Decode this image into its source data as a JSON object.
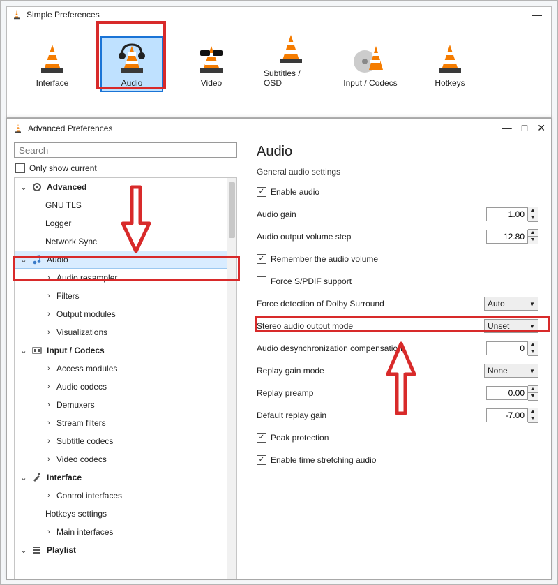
{
  "simple": {
    "title": "Simple Preferences",
    "minimize_glyph": "—",
    "categories": {
      "interface": "Interface",
      "audio": "Audio",
      "video": "Video",
      "subtitles": "Subtitles / OSD",
      "input_codecs": "Input / Codecs",
      "hotkeys": "Hotkeys"
    }
  },
  "advanced": {
    "title": "Advanced Preferences",
    "winbtns": {
      "min": "—",
      "max": "□",
      "close": "✕"
    },
    "search_placeholder": "Search",
    "only_show_current": "Only show current",
    "tree": {
      "advanced": {
        "label": "Advanced",
        "children": {
          "gnu_tls": "GNU TLS",
          "logger": "Logger",
          "network_sync": "Network Sync"
        }
      },
      "audio": {
        "label": "Audio",
        "children": {
          "resampler": "Audio resampler",
          "filters": "Filters",
          "output_modules": "Output modules",
          "visualizations": "Visualizations"
        }
      },
      "input_codecs": {
        "label": "Input / Codecs",
        "children": {
          "access_modules": "Access modules",
          "audio_codecs": "Audio codecs",
          "demuxers": "Demuxers",
          "stream_filters": "Stream filters",
          "subtitle_codecs": "Subtitle codecs",
          "video_codecs": "Video codecs"
        }
      },
      "interface": {
        "label": "Interface",
        "children": {
          "control_interfaces": "Control interfaces",
          "hotkeys_settings": "Hotkeys settings",
          "main_interfaces": "Main interfaces"
        }
      },
      "playlist": {
        "label": "Playlist"
      }
    },
    "panel": {
      "heading": "Audio",
      "subheading": "General audio settings",
      "rows": {
        "enable_audio": {
          "label": "Enable audio",
          "checked": true
        },
        "audio_gain": {
          "label": "Audio gain",
          "value": "1.00"
        },
        "output_volume_step": {
          "label": "Audio output volume step",
          "value": "12.80"
        },
        "remember_volume": {
          "label": "Remember the audio volume",
          "checked": true
        },
        "force_spdif": {
          "label": "Force S/PDIF support",
          "checked": false
        },
        "dolby": {
          "label": "Force detection of Dolby Surround",
          "value": "Auto"
        },
        "stereo_mode": {
          "label": "Stereo audio output mode",
          "value": "Unset"
        },
        "desync": {
          "label": "Audio desynchronization compensation",
          "value": "0"
        },
        "replay_gain_mode": {
          "label": "Replay gain mode",
          "value": "None"
        },
        "replay_preamp": {
          "label": "Replay preamp",
          "value": "0.00"
        },
        "default_replay_gain": {
          "label": "Default replay gain",
          "value": "-7.00"
        },
        "peak_protection": {
          "label": "Peak protection",
          "checked": true
        },
        "time_stretching": {
          "label": "Enable time stretching audio",
          "checked": true
        }
      }
    }
  }
}
